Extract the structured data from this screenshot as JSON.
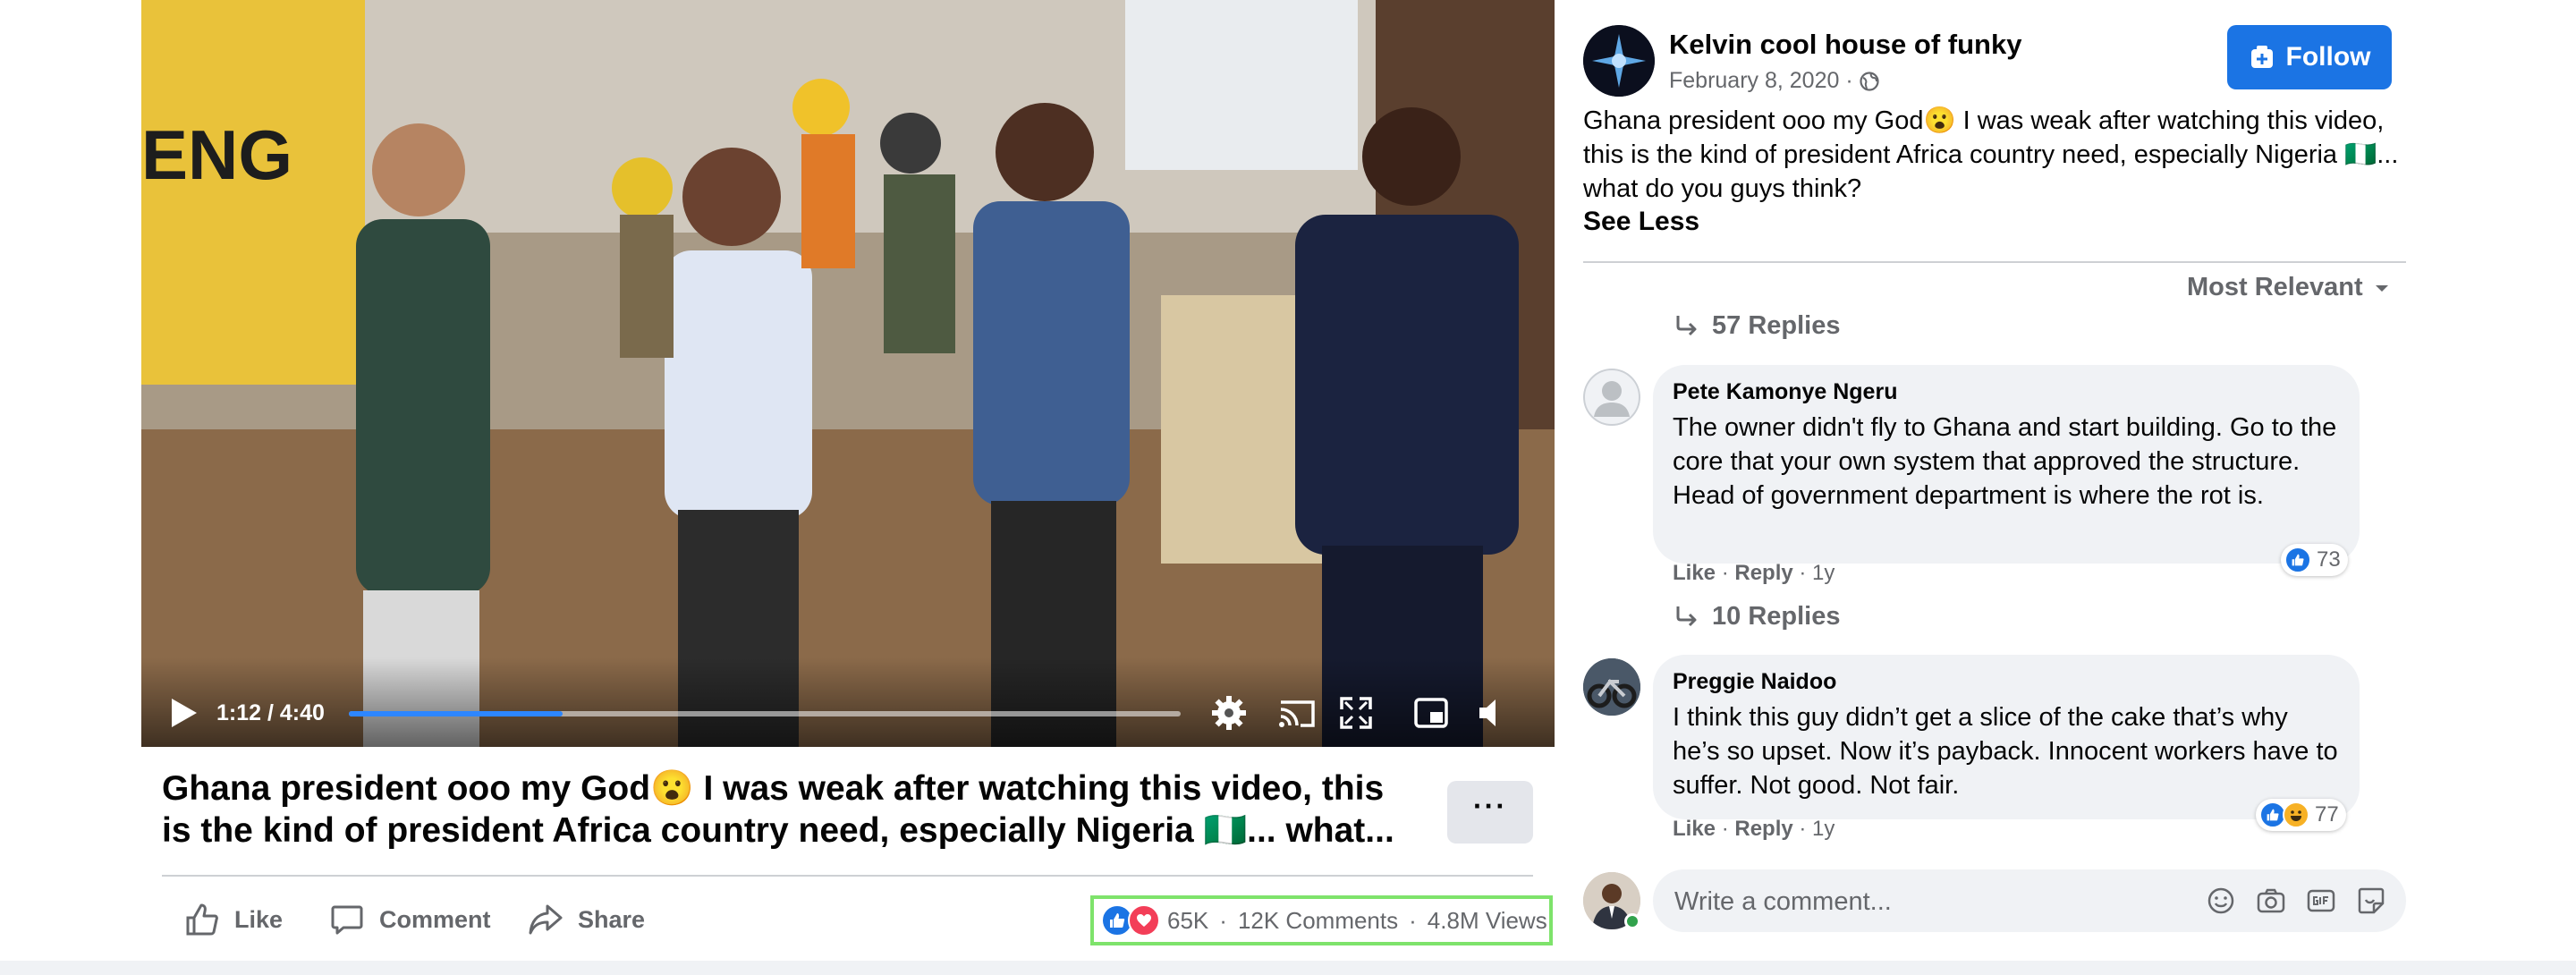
{
  "video": {
    "time": "1:12 / 4:40",
    "progress_fraction": 0.257
  },
  "post": {
    "title": "Ghana president ooo my God😮 I was weak after watching this video, this is the kind of president Africa country need, especially Nigeria 🇳🇬... what...",
    "more_label": "···",
    "actions": {
      "like": "Like",
      "comment": "Comment",
      "share": "Share"
    },
    "stats": {
      "reactions": "65K",
      "sep1": "·",
      "comments": "12K Comments",
      "sep2": "·",
      "views": "4.8M Views"
    }
  },
  "page": {
    "name": "Kelvin cool house of funky",
    "date": "February 8, 2020 ·",
    "follow_label": "Follow",
    "text": "Ghana president ooo my God😮 I was weak after watching this video, this is the kind of president Africa country need, especially Nigeria 🇳🇬... what do you guys think?",
    "see_less": "See Less"
  },
  "comments": {
    "sort_label": "Most Relevant",
    "top_replies": "57 Replies",
    "items": [
      {
        "author": "Pete Kamonye Ngeru",
        "text": "The owner didn't fly to Ghana and start building. Go to the core that your own system that approved the structure. Head of government department is where the rot is.",
        "like": "Like",
        "reply": "Reply",
        "age": "1y",
        "reaction_count": "73",
        "replies": "10 Replies"
      },
      {
        "author": "Preggie Naidoo",
        "text": "I think this guy didn’t get a slice of the cake that’s why he’s so upset. Now it’s payback. Innocent workers have to suffer. Not good. Not fair.",
        "like": "Like",
        "reply": "Reply",
        "age": "1y",
        "reaction_count": "77"
      }
    ],
    "write_placeholder": "Write a comment..."
  },
  "colors": {
    "accent": "#1b74e4",
    "progress": "#2d86ff",
    "highlight_box": "#7ee36b",
    "secondary_text": "#65676b",
    "online": "#31a24c"
  },
  "icons": {
    "video": [
      "play-icon",
      "settings-gear-icon",
      "cast-icon",
      "fullscreen-icon",
      "miniplayer-icon",
      "volume-icon"
    ],
    "actions": [
      "like-thumb-icon",
      "comment-bubble-icon",
      "share-arrow-icon"
    ],
    "write": [
      "emoji-icon",
      "camera-icon",
      "gif-icon",
      "sticker-icon"
    ]
  }
}
